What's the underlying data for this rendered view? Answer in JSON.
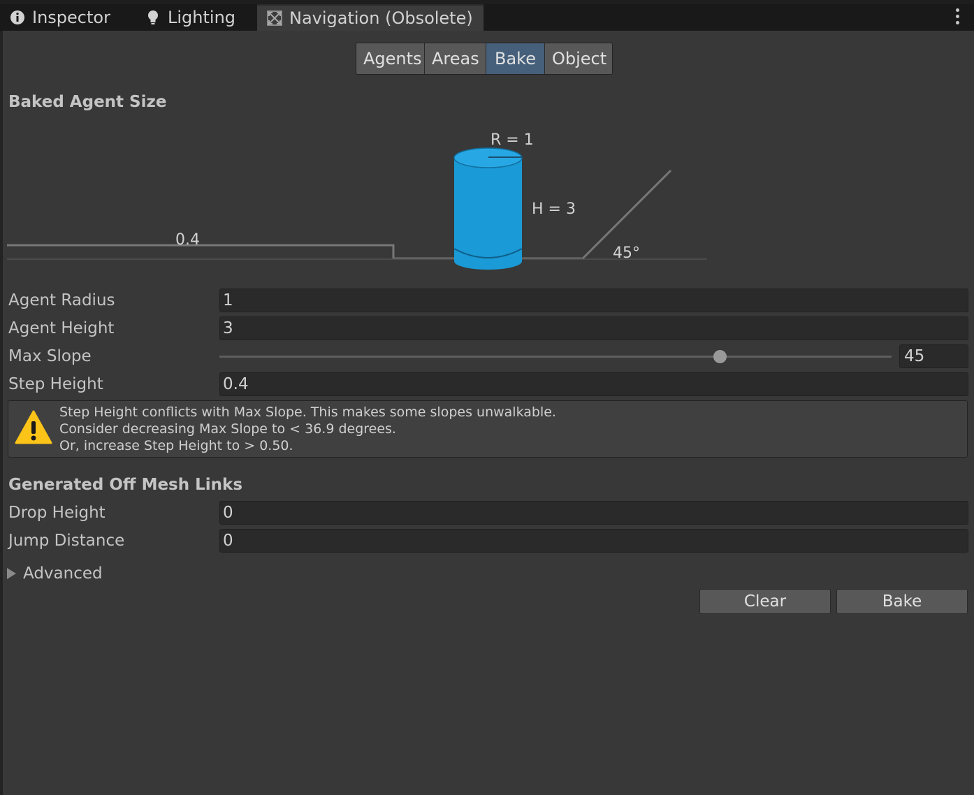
{
  "tabs": [
    {
      "label": "Inspector",
      "icon": "info-icon"
    },
    {
      "label": "Lighting",
      "icon": "lightbulb-icon"
    },
    {
      "label": "Navigation (Obsolete)",
      "icon": "navigation-icon",
      "active": true
    }
  ],
  "toolbar": {
    "items": [
      "Agents",
      "Areas",
      "Bake",
      "Object"
    ],
    "selected": "Bake"
  },
  "baked_agent_size": {
    "title": "Baked Agent Size",
    "diagram": {
      "radius_label": "R = 1",
      "height_label": "H = 3",
      "step_label": "0.4",
      "slope_label": "45°",
      "agent_color": "#1a9ad6"
    }
  },
  "fields": {
    "agent_radius": {
      "label": "Agent Radius",
      "value": "1"
    },
    "agent_height": {
      "label": "Agent Height",
      "value": "3"
    },
    "max_slope": {
      "label": "Max Slope",
      "value": "45",
      "fraction": 0.745
    },
    "step_height": {
      "label": "Step Height",
      "value": "0.4"
    }
  },
  "warning": {
    "icon": "warning-icon",
    "lines": [
      "Step Height conflicts with Max Slope. This makes some slopes unwalkable.",
      "Consider decreasing Max Slope to < 36.9 degrees.",
      "Or, increase Step Height to > 0.50."
    ]
  },
  "off_mesh": {
    "title": "Generated Off Mesh Links",
    "drop_height": {
      "label": "Drop Height",
      "value": "0"
    },
    "jump_distance": {
      "label": "Jump Distance",
      "value": "0"
    }
  },
  "advanced": {
    "label": "Advanced",
    "expanded": false
  },
  "buttons": {
    "clear": "Clear",
    "bake": "Bake"
  },
  "colors": {
    "selected_tab": "#46607c",
    "background": "#383838"
  }
}
